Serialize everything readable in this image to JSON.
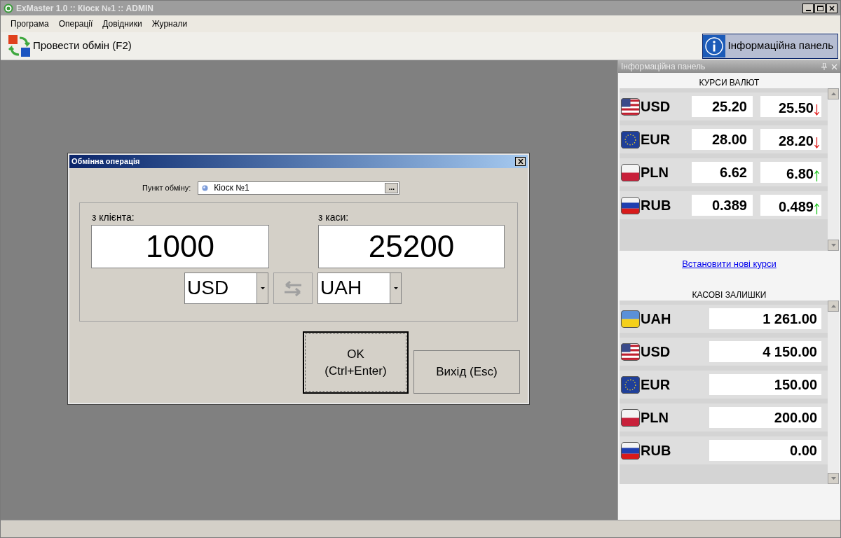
{
  "window": {
    "title": "ExMaster 1.0 :: Кіоск №1 :: ADMIN"
  },
  "menu": [
    "Програма",
    "Операції",
    "Довідники",
    "Журнали"
  ],
  "toolbar": {
    "exchange_button": "Провести обмін (F2)",
    "info_button": {
      "label": "Інформаційна панель",
      "selected": true
    }
  },
  "dialog": {
    "title": "Обмінна операція",
    "point_label": "Пункт обміну:",
    "point_value": "Кіоск №1",
    "browse_button": "...",
    "from_label": "з клієнта:",
    "from_amount": "1000",
    "from_currency": "USD",
    "to_label": "з каси:",
    "to_amount": "25200",
    "to_currency": "UAH",
    "ok_button": {
      "line1": "OK",
      "line2": "(Ctrl+Enter)"
    },
    "exit_button": "Вихід (Esc)"
  },
  "info_panel": {
    "title": "Інформаційна панель",
    "rates_title": "КУРСИ ВАЛЮТ",
    "rates": [
      {
        "kind": "us",
        "code": "USD",
        "buy": "25.20",
        "sell": "25.50",
        "rising": false
      },
      {
        "kind": "eu",
        "code": "EUR",
        "buy": "28.00",
        "sell": "28.20",
        "rising": false
      },
      {
        "kind": "pl",
        "code": "PLN",
        "buy": "6.62",
        "sell": "6.80",
        "rising": true
      },
      {
        "kind": "ru",
        "code": "RUB",
        "buy": "0.389",
        "sell": "0.489",
        "rising": true
      }
    ],
    "set_rates_link": "Встановити нові курси",
    "balances_title": "КАСОВІ ЗАЛИШКИ",
    "balances": [
      {
        "kind": "ua",
        "code": "UAH",
        "amount": "1 261.00"
      },
      {
        "kind": "us",
        "code": "USD",
        "amount": "4 150.00"
      },
      {
        "kind": "eu",
        "code": "EUR",
        "amount": "150.00"
      },
      {
        "kind": "pl",
        "code": "PLN",
        "amount": "200.00"
      },
      {
        "kind": "ru",
        "code": "RUB",
        "amount": "0.00"
      }
    ]
  }
}
